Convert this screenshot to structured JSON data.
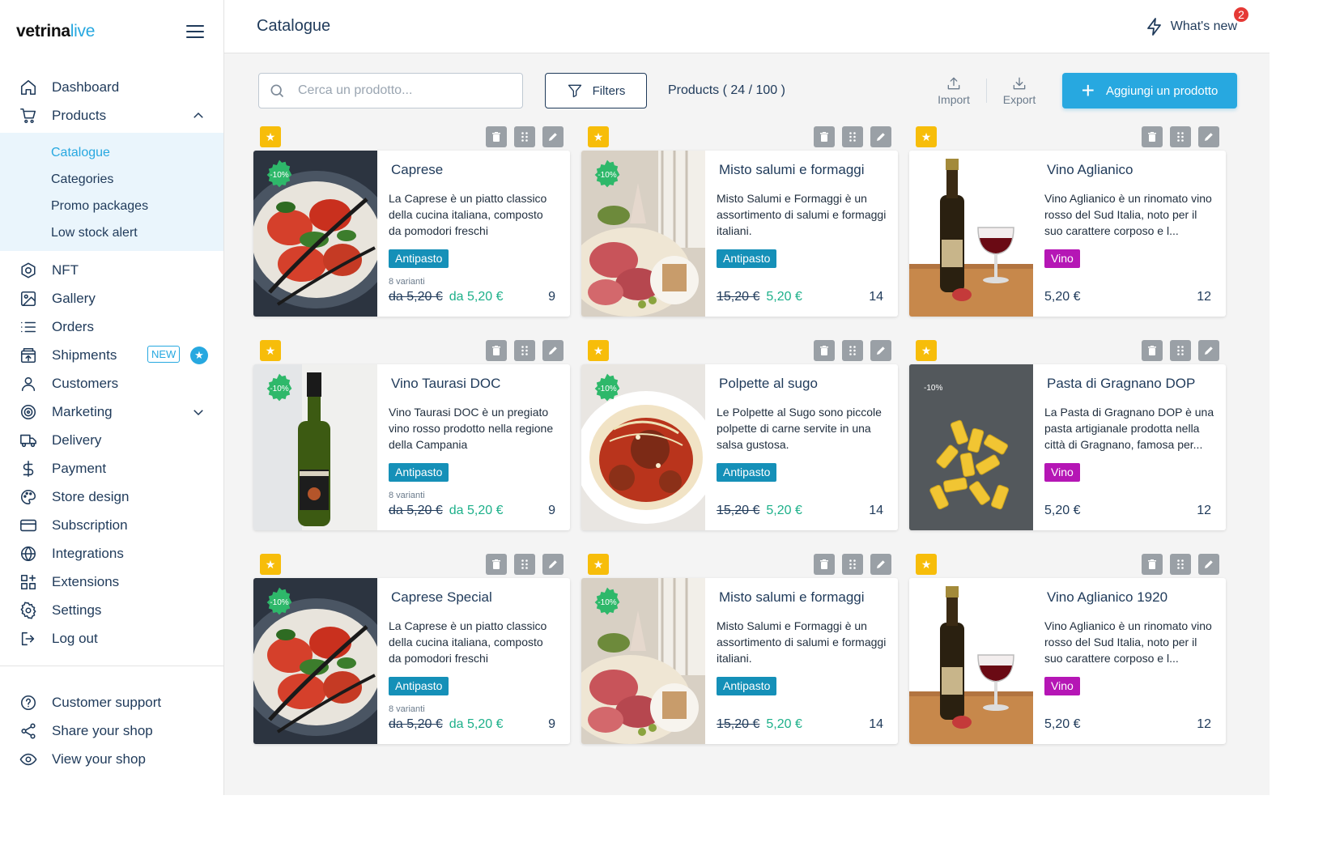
{
  "brand": {
    "part1": "vetrina",
    "part2": "live"
  },
  "sidebar": {
    "nav": [
      {
        "label": "Dashboard",
        "icon": "home-icon"
      },
      {
        "label": "Products",
        "icon": "cart-icon",
        "expanded": true
      }
    ],
    "submenu": [
      {
        "label": "Catalogue",
        "active": true
      },
      {
        "label": "Categories"
      },
      {
        "label": "Promo packages"
      },
      {
        "label": "Low stock alert"
      }
    ],
    "nav2": [
      {
        "label": "NFT",
        "icon": "nft-icon"
      },
      {
        "label": "Gallery",
        "icon": "image-icon"
      },
      {
        "label": "Orders",
        "icon": "list-icon"
      },
      {
        "label": "Shipments",
        "icon": "box-icon",
        "badge": "NEW"
      },
      {
        "label": "Customers",
        "icon": "user-icon"
      },
      {
        "label": "Marketing",
        "icon": "target-icon"
      },
      {
        "label": "Delivery",
        "icon": "truck-icon"
      },
      {
        "label": "Payment",
        "icon": "dollar-icon"
      },
      {
        "label": "Store design",
        "icon": "palette-icon"
      },
      {
        "label": "Subscription",
        "icon": "card-icon"
      },
      {
        "label": "Integrations",
        "icon": "globe-icon"
      },
      {
        "label": "Extensions",
        "icon": "apps-icon"
      },
      {
        "label": "Settings",
        "icon": "gear-icon"
      },
      {
        "label": "Log out",
        "icon": "logout-icon"
      }
    ],
    "bottom": [
      {
        "label": "Customer support",
        "icon": "help-icon"
      },
      {
        "label": "Share your shop",
        "icon": "share-icon"
      },
      {
        "label": "View your shop",
        "icon": "eye-icon"
      }
    ]
  },
  "header": {
    "title": "Catalogue",
    "whats_new": "What's new",
    "notifications": "2"
  },
  "toolbar": {
    "search_placeholder": "Cerca un prodotto...",
    "filters_label": "Filters",
    "products_count": "Products ( 24 / 100 )",
    "import_label": "Import",
    "export_label": "Export",
    "add_label": "Aggiungi un prodotto"
  },
  "products": [
    {
      "name": "Caprese",
      "desc": "La Caprese è un piatto classico della cucina italiana, composto da pomodori freschi",
      "tag": "Antipasto",
      "tag_kind": "antipasto",
      "variants": "8 varianti",
      "old_price": "da 5,20 €",
      "price": "da 5,20 €",
      "stock": "9",
      "discount": "-10%",
      "image": "caprese"
    },
    {
      "name": "Misto salumi e formaggi",
      "desc": "Misto Salumi e Formaggi è un assortimento di salumi e formaggi italiani.",
      "tag": "Antipasto",
      "tag_kind": "antipasto",
      "variants": "",
      "old_price": "15,20 €",
      "price": "5,20 €",
      "stock": "14",
      "discount": "-10%",
      "image": "salumi"
    },
    {
      "name": "Vino Aglianico",
      "desc": "Vino Aglianico è un rinomato vino rosso del Sud Italia, noto per il suo carattere corposo e l...",
      "tag": "Vino",
      "tag_kind": "vino",
      "variants": "",
      "old_price": "",
      "price": "5,20 €",
      "stock": "12",
      "discount": "",
      "image": "redwine"
    },
    {
      "name": "Vino Taurasi DOC",
      "desc": "Vino Taurasi DOC è un pregiato vino rosso prodotto nella regione della Campania",
      "tag": "Antipasto",
      "tag_kind": "antipasto",
      "variants": "8 varianti",
      "old_price": "da 5,20 €",
      "price": "da 5,20 €",
      "stock": "9",
      "discount": "-10%",
      "image": "whitewine"
    },
    {
      "name": "Polpette al sugo",
      "desc": "Le Polpette al Sugo sono piccole polpette di carne servite in una salsa gustosa.",
      "tag": "Antipasto",
      "tag_kind": "antipasto",
      "variants": "",
      "old_price": "15,20 €",
      "price": "5,20 €",
      "stock": "14",
      "discount": "-10%",
      "image": "polpette"
    },
    {
      "name": "Pasta di Gragnano DOP",
      "desc": "La Pasta di Gragnano DOP è una pasta artigianale prodotta nella città di Gragnano, famosa per...",
      "tag": "Vino",
      "tag_kind": "vino",
      "variants": "",
      "old_price": "",
      "price": "5,20 €",
      "stock": "12",
      "discount": "-10%",
      "discount_plain": true,
      "image": "pasta"
    },
    {
      "name": "Caprese Special",
      "desc": "La Caprese è un piatto classico della cucina italiana, composto da pomodori freschi",
      "tag": "Antipasto",
      "tag_kind": "antipasto",
      "variants": "8 varianti",
      "old_price": "da 5,20 €",
      "price": "da 5,20 €",
      "stock": "9",
      "discount": "-10%",
      "image": "caprese"
    },
    {
      "name": "Misto salumi e formaggi",
      "desc": "Misto Salumi e Formaggi è un assortimento di salumi e formaggi italiani.",
      "tag": "Antipasto",
      "tag_kind": "antipasto",
      "variants": "",
      "old_price": "15,20 €",
      "price": "5,20 €",
      "stock": "14",
      "discount": "-10%",
      "image": "salumi"
    },
    {
      "name": "Vino Aglianico 1920",
      "desc": "Vino Aglianico è un rinomato vino rosso del Sud Italia, noto per il suo carattere corposo e l...",
      "tag": "Vino",
      "tag_kind": "vino",
      "variants": "",
      "old_price": "",
      "price": "5,20 €",
      "stock": "12",
      "discount": "",
      "image": "redwine"
    }
  ]
}
